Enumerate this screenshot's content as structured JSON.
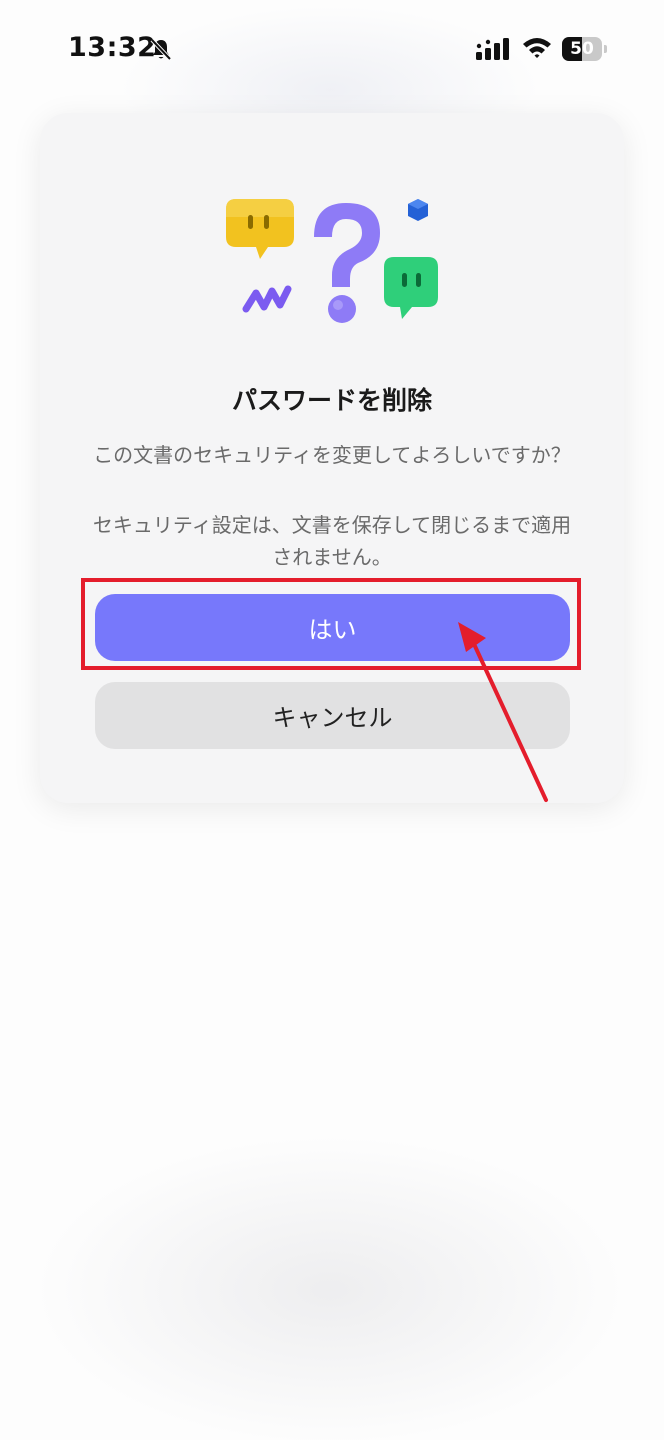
{
  "status_bar": {
    "time": "13:32",
    "battery_percent": "50",
    "icons": [
      "bell-slash-icon",
      "cellular-signal-icon",
      "wifi-icon",
      "battery-icon"
    ]
  },
  "dialog": {
    "title": "パスワードを削除",
    "message_line1": "この文書のセキュリティを変更してよろしいですか？",
    "message_line2": "セキュリティ設定は、文書を保存して閉じるまで適用されません。",
    "confirm_label": "はい",
    "cancel_label": "キャンセル",
    "accent_color": "#7778FB"
  },
  "annotation": {
    "highlight_color": "#E41D2C"
  }
}
